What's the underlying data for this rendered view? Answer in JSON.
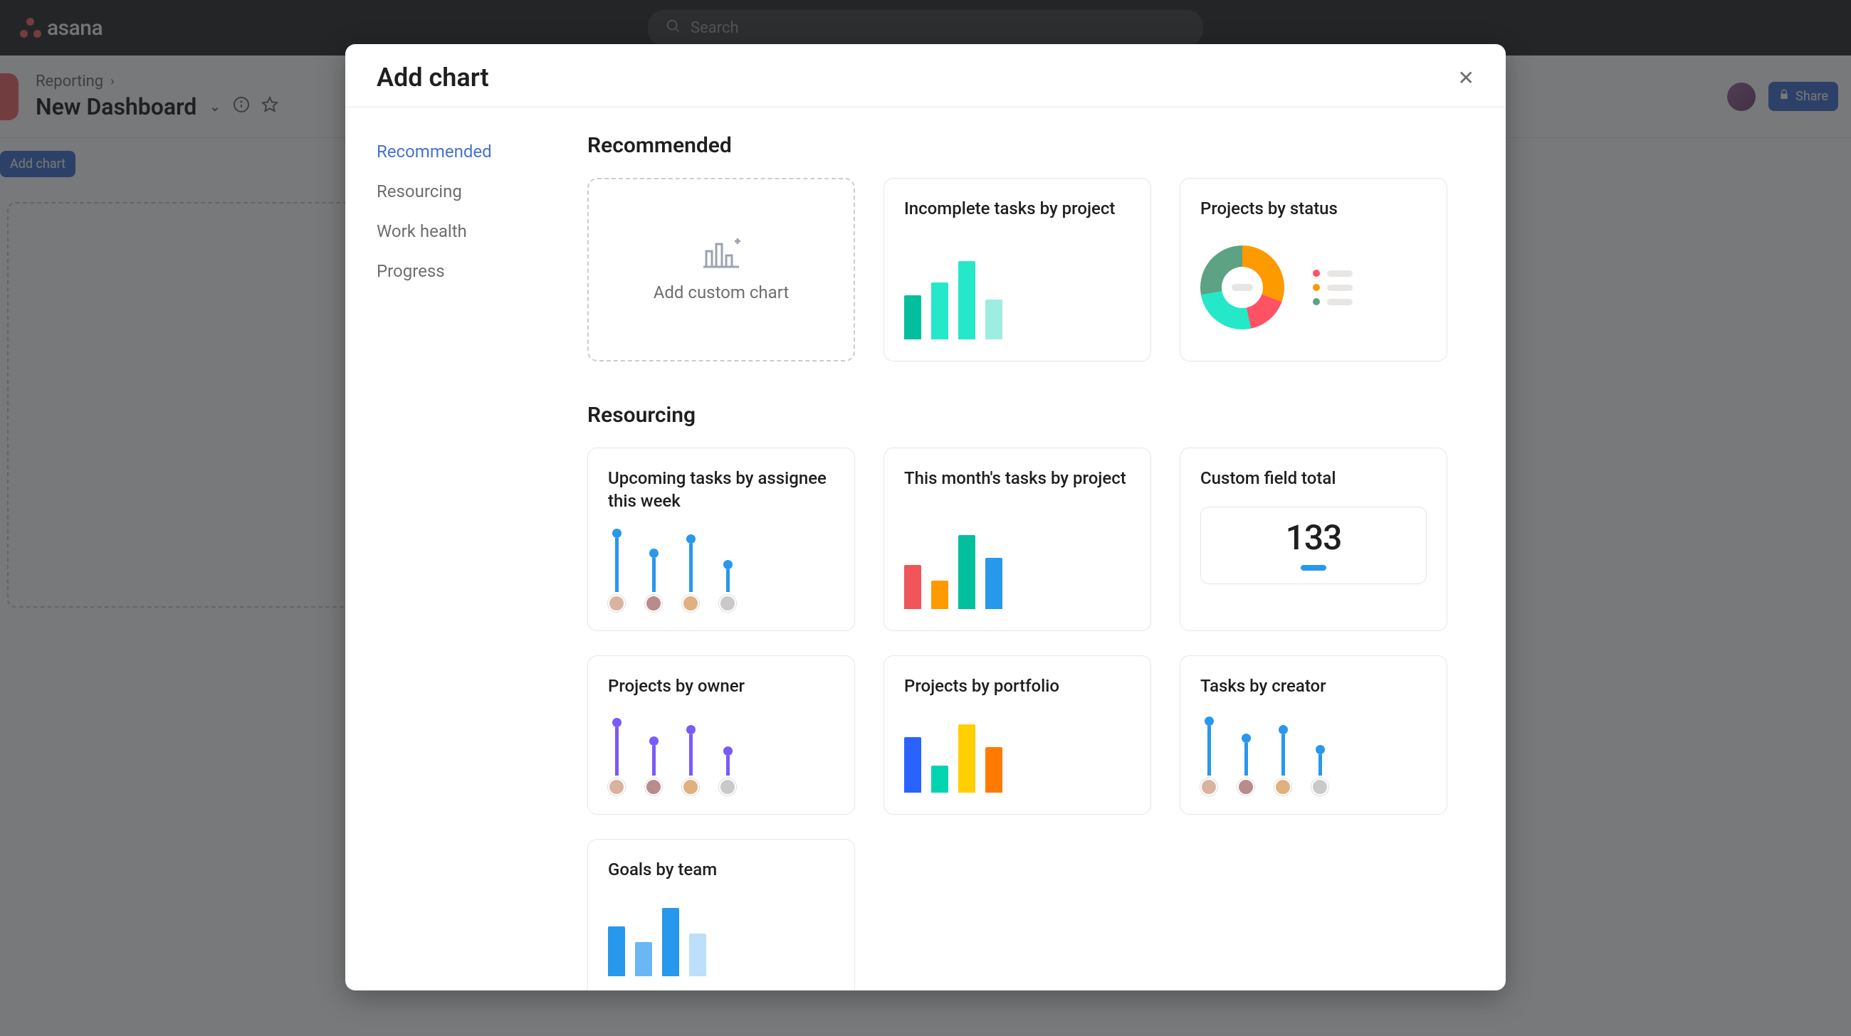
{
  "app": {
    "logo_text": "asana",
    "search_placeholder": "Search"
  },
  "header": {
    "breadcrumb": "Reporting",
    "title": "New Dashboard",
    "share_label": "Share",
    "add_chart_pill": "Add chart"
  },
  "modal": {
    "title": "Add chart",
    "sidebar": [
      {
        "id": "recommended",
        "label": "Recommended",
        "active": true
      },
      {
        "id": "resourcing",
        "label": "Resourcing",
        "active": false
      },
      {
        "id": "work-health",
        "label": "Work health",
        "active": false
      },
      {
        "id": "progress",
        "label": "Progress",
        "active": false
      }
    ],
    "sections": {
      "recommended": {
        "title": "Recommended",
        "custom_label": "Add custom chart",
        "cards": [
          {
            "id": "incomplete-tasks-by-project",
            "title": "Incomplete tasks by project"
          },
          {
            "id": "projects-by-status",
            "title": "Projects by status"
          }
        ]
      },
      "resourcing": {
        "title": "Resourcing",
        "cards": [
          {
            "id": "upcoming-tasks-by-assignee",
            "title": "Upcoming tasks by assignee this week"
          },
          {
            "id": "this-months-tasks-by-project",
            "title": "This month's tasks by project"
          },
          {
            "id": "custom-field-total",
            "title": "Custom field total",
            "value": "133"
          },
          {
            "id": "projects-by-owner",
            "title": "Projects by owner"
          },
          {
            "id": "projects-by-portfolio",
            "title": "Projects by portfolio"
          },
          {
            "id": "tasks-by-creator",
            "title": "Tasks by creator"
          },
          {
            "id": "goals-by-team",
            "title": "Goals by team"
          }
        ]
      }
    }
  }
}
